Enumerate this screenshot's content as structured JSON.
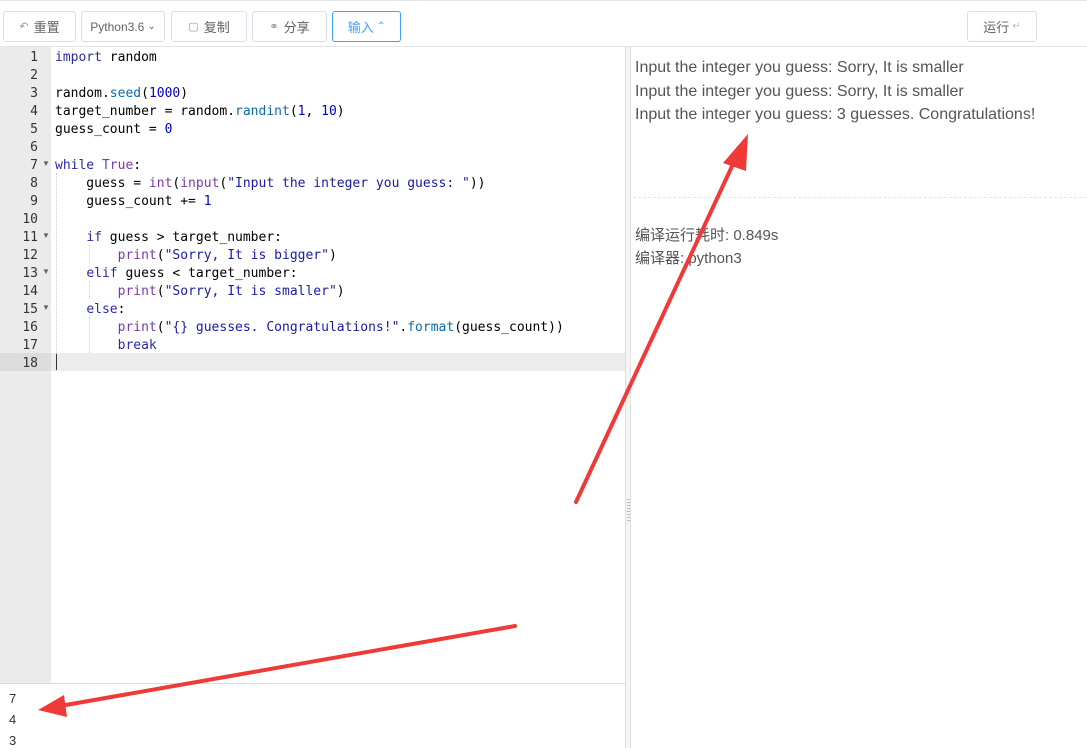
{
  "toolbar": {
    "reset_label": "重置",
    "language": "Python3.6",
    "copy_label": "复制",
    "share_label": "分享",
    "input_label": "输入",
    "run_label": "运行"
  },
  "editor": {
    "line_numbers": [
      "1",
      "2",
      "3",
      "4",
      "5",
      "6",
      "7",
      "8",
      "9",
      "10",
      "11",
      "12",
      "13",
      "14",
      "15",
      "16",
      "17",
      "18"
    ],
    "lines": [
      "import random",
      "",
      "random.seed(1000)",
      "target_number = random.randint(1, 10)",
      "guess_count = 0",
      "",
      "while True:",
      "    guess = int(input(\"Input the integer you guess: \"))",
      "    guess_count += 1",
      "",
      "    if guess > target_number:",
      "        print(\"Sorry, It is bigger\")",
      "    elif guess < target_number:",
      "        print(\"Sorry, It is smaller\")",
      "    else:",
      "        print(\"{} guesses. Congratulations!\".format(guess_count))",
      "        break",
      ""
    ],
    "active_line": 18
  },
  "input": {
    "lines": [
      "7",
      "4",
      "3"
    ]
  },
  "output": {
    "lines": [
      "Input the integer you guess: Sorry, It is smaller",
      "Input the integer you guess: Sorry, It is smaller",
      "Input the integer you guess: 3 guesses. Congratulations!"
    ],
    "runtime": "编译运行耗时: 0.849s",
    "compiler": "编译器: python3"
  },
  "colors": {
    "accent": "#409eff",
    "arrow": "#f03a37"
  }
}
